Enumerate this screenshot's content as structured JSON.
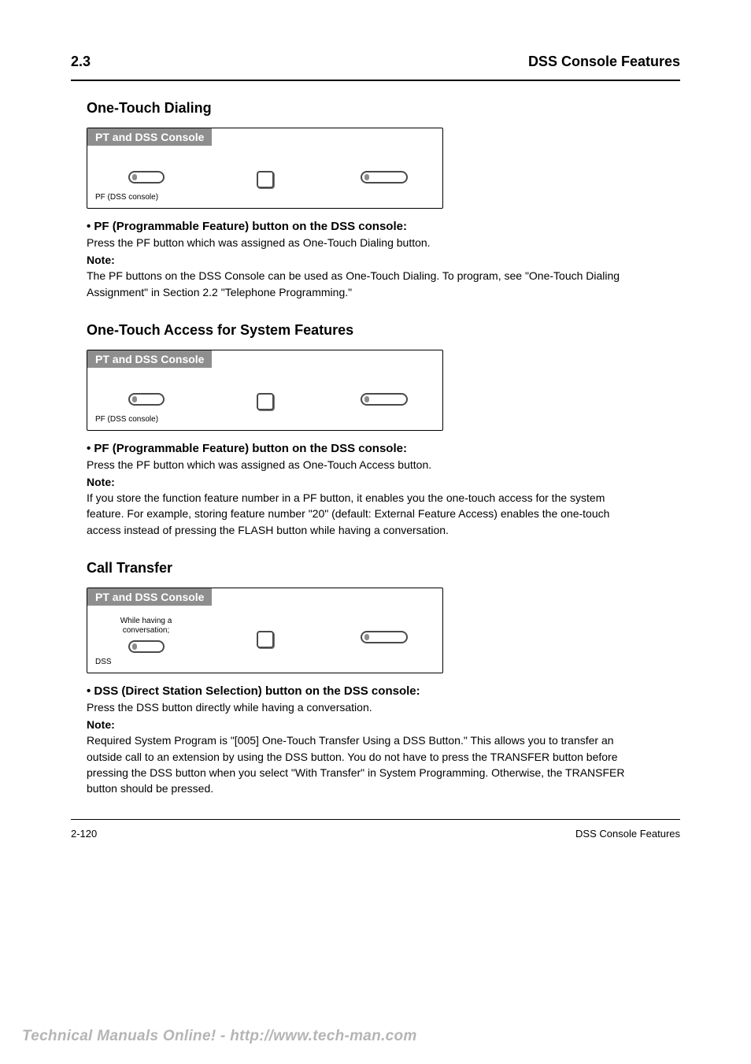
{
  "header": {
    "chapter_number": "2.3",
    "chapter_subtitle": "DSS Console Features"
  },
  "sections": [
    {
      "title": "One-Touch Dialing",
      "step": {
        "tag": "PT and DSS Console",
        "col1_label": "",
        "col3_label": "",
        "foot_left": "PF (DSS console)",
        "foot_right": ""
      },
      "desc_lead": "•   PF (Programmable Feature) button on the DSS console:",
      "desc_body": "Press the PF button which was assigned as One-Touch Dialing button.",
      "note_title": "Note:",
      "note_body": "The PF buttons on the DSS Console can be used as One-Touch Dialing. To program, see \"One-Touch Dialing Assignment\" in Section 2.2 \"Telephone Programming.\""
    },
    {
      "title": "One-Touch Access for System Features",
      "step": {
        "tag": "PT and DSS Console",
        "col1_label": "",
        "col3_label": "",
        "foot_left": "PF (DSS console)",
        "foot_right": ""
      },
      "desc_lead": "•   PF (Programmable Feature) button on the DSS console:",
      "desc_body": "Press the PF button which was assigned as One-Touch Access button.",
      "note_title": "Note:",
      "note_body": "If you store the function feature number in a PF button, it enables you the one-touch access for the system feature. For example, storing feature number \"20\" (default: External Feature Access) enables the one-touch access instead of pressing the FLASH button while having a conversation."
    },
    {
      "title": "Call Transfer",
      "step": {
        "tag": "PT and DSS Console",
        "col1_label": "While having a conversation;",
        "col3_label": "",
        "foot_left": "DSS",
        "foot_right": ""
      },
      "desc_lead": "•   DSS (Direct Station Selection) button on the DSS console:",
      "desc_body": "Press the DSS button directly while having a conversation.",
      "note_title": "Note:",
      "note_body": "Required System Program is \"[005] One-Touch Transfer Using a DSS Button.\" This allows you to transfer an outside call to an extension by using the DSS button. You do not have to press the TRANSFER button before pressing the DSS button when you select \"With Transfer\" in System Programming. Otherwise, the TRANSFER button should be pressed."
    }
  ],
  "footer": {
    "left": "2-120",
    "right": "DSS Console Features"
  },
  "watermark": "Technical Manuals Online! - http://www.tech-man.com"
}
